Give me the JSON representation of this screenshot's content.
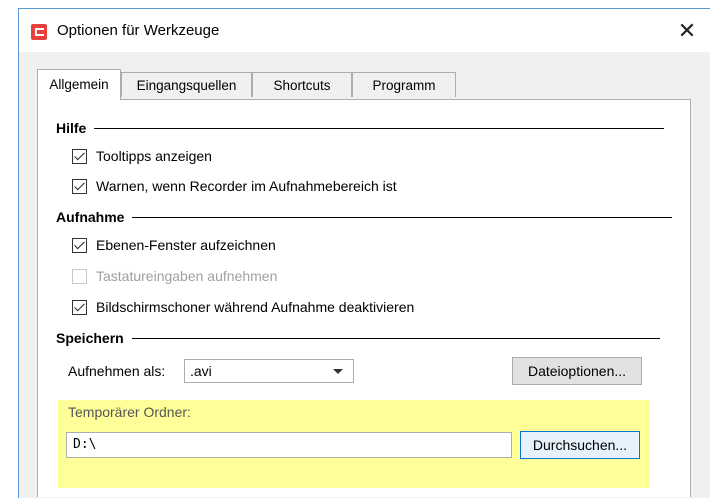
{
  "window": {
    "title": "Optionen für Werkzeuge",
    "close_glyph": "✕"
  },
  "tabs": [
    {
      "label": "Allgemein",
      "active": true
    },
    {
      "label": "Eingangsquellen",
      "active": false
    },
    {
      "label": "Shortcuts",
      "active": false
    },
    {
      "label": "Programm",
      "active": false
    }
  ],
  "groups": {
    "hilfe": {
      "title": "Hilfe",
      "items": [
        {
          "label": "Tooltipps anzeigen",
          "checked": true,
          "enabled": true
        },
        {
          "label": "Warnen, wenn Recorder im Aufnahmebereich ist",
          "checked": true,
          "enabled": true
        }
      ]
    },
    "aufnahme": {
      "title": "Aufnahme",
      "items": [
        {
          "label": "Ebenen-Fenster aufzeichnen",
          "checked": true,
          "enabled": true
        },
        {
          "label": "Tastatureingaben aufnehmen",
          "checked": false,
          "enabled": false
        },
        {
          "label": "Bildschirmschoner während Aufnahme deaktivieren",
          "checked": true,
          "enabled": true
        }
      ]
    },
    "speichern": {
      "title": "Speichern",
      "save_as_label": "Aufnehmen als:",
      "save_as_value": ".avi",
      "file_options_button": "Dateioptionen...",
      "temp_folder_label": "Temporärer Ordner:",
      "temp_folder_value": "D:\\",
      "browse_button": "Durchsuchen..."
    }
  },
  "colors": {
    "highlight": "#ffff99",
    "accent": "#0078d7",
    "app_icon": "#e8413c"
  },
  "icons": {
    "app": "app-logo-icon",
    "close": "close-icon",
    "dropdown": "chevron-down-icon",
    "check": "check-icon"
  }
}
